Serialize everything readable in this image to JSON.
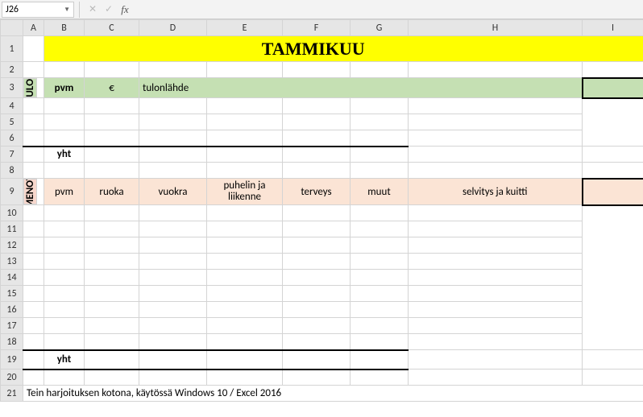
{
  "formula_bar": {
    "cell_ref": "J26",
    "fx_label": "fx"
  },
  "columns": [
    "A",
    "B",
    "C",
    "D",
    "E",
    "F",
    "G",
    "H",
    "I"
  ],
  "rows": [
    "1",
    "2",
    "3",
    "4",
    "5",
    "6",
    "7",
    "8",
    "9",
    "10",
    "11",
    "12",
    "13",
    "14",
    "15",
    "16",
    "17",
    "18",
    "19",
    "20",
    "21"
  ],
  "title": "TAMMIKUU",
  "tulot": {
    "label": "TULOT",
    "headers": {
      "pvm": "pvm",
      "eur": "€",
      "lahde": "tulonlähde"
    },
    "yht": "yht"
  },
  "menot": {
    "label": "MENOT",
    "headers": {
      "pvm": "pvm",
      "ruoka": "ruoka",
      "vuokra": "vuokra",
      "puhelin": "puhelin ja liikenne",
      "terveys": "terveys",
      "muut": "muut",
      "selvitys": "selvitys ja kuitti"
    },
    "yht": "yht"
  },
  "footer": "Tein harjoituksen kotona, käytössä Windows 10 / Excel 2016"
}
